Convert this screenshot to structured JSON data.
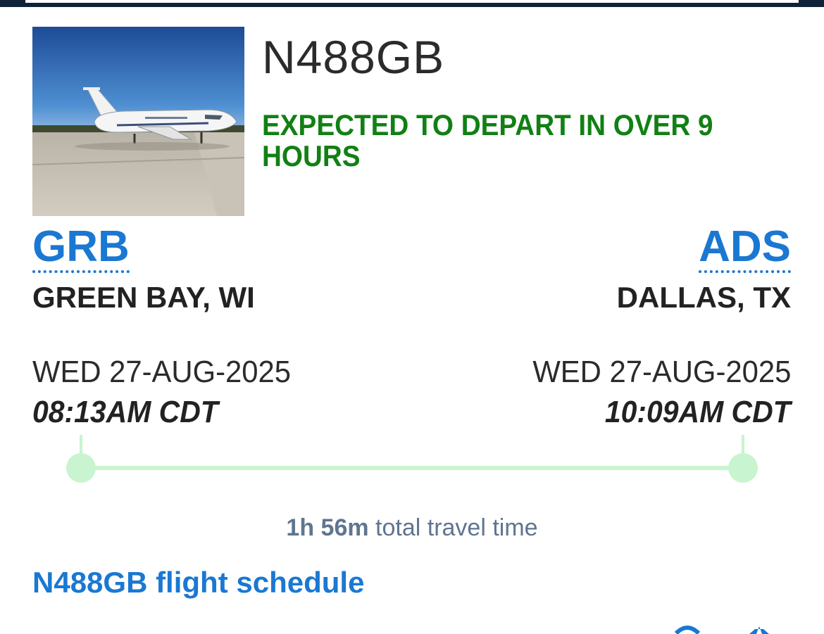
{
  "flight": {
    "tail_number": "N488GB",
    "status": "EXPECTED TO DEPART IN OVER 9 HOURS",
    "status_color": "#118014",
    "photo_alt": "aircraft-photo"
  },
  "origin": {
    "code": "GRB",
    "city": "GREEN BAY, WI",
    "date": "WED 27-AUG-2025",
    "time": "08:13AM CDT"
  },
  "destination": {
    "code": "ADS",
    "city": "DALLAS, TX",
    "date": "WED 27-AUG-2025",
    "time": "10:09AM CDT"
  },
  "travel": {
    "duration": "1h 56m",
    "suffix": " total travel time",
    "progress": 0
  },
  "links": {
    "schedule": "N488GB flight schedule"
  },
  "colors": {
    "link": "#1a78d2",
    "timeline": "#c8f5cf",
    "topbar": "#0f2237"
  }
}
